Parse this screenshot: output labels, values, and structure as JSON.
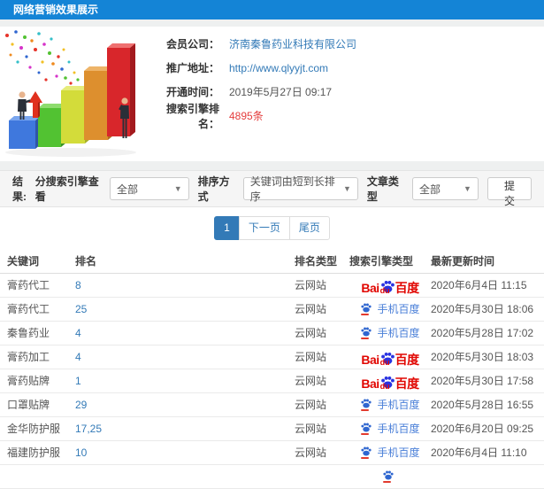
{
  "window": {
    "title": "网络营销效果展示"
  },
  "info_panel": {
    "fields": [
      {
        "label": "会员公司：",
        "value": "济南秦鲁药业科技有限公司"
      },
      {
        "label": "推广地址：",
        "value": "http://www.qlyyjt.com"
      },
      {
        "label": "开通时间：",
        "value": "2019年5月27日 09:17"
      },
      {
        "label": "搜索引擎排名：",
        "value": "4895条"
      }
    ]
  },
  "filter_bar": {
    "results_label": "结果:",
    "engine_view_label": "分搜索引擎查看",
    "engine_view_value": "全部",
    "sort_label": "排序方式",
    "sort_value": "关键词由短到长排序",
    "article_type_label": "文章类型",
    "article_type_value": "全部",
    "submit_label": "提交"
  },
  "pagination": {
    "current_page": "1",
    "next_label": "下一页",
    "last_label": "尾页"
  },
  "table": {
    "columns": [
      "关键词",
      "排名",
      "排名类型",
      "搜索引擎类型",
      "最新更新时间"
    ],
    "rows": [
      {
        "keyword": "膏药代工",
        "rank": "8",
        "rank_type": "云网站",
        "engine": "baidu",
        "updated": "2020年6月4日 11:15"
      },
      {
        "keyword": "膏药代工",
        "rank": "25",
        "rank_type": "云网站",
        "engine": "mobile",
        "updated": "2020年5月30日 18:06"
      },
      {
        "keyword": "秦鲁药业",
        "rank": "4",
        "rank_type": "云网站",
        "engine": "mobile",
        "updated": "2020年5月28日 17:02"
      },
      {
        "keyword": "膏药加工",
        "rank": "4",
        "rank_type": "云网站",
        "engine": "baidu",
        "updated": "2020年5月30日 18:03"
      },
      {
        "keyword": "膏药贴牌",
        "rank": "1",
        "rank_type": "云网站",
        "engine": "baidu",
        "updated": "2020年5月30日 17:58"
      },
      {
        "keyword": "口罩贴牌",
        "rank": "29",
        "rank_type": "云网站",
        "engine": "mobile",
        "updated": "2020年5月28日 16:55"
      },
      {
        "keyword": "金华防护服",
        "rank": "17,25",
        "rank_type": "云网站",
        "engine": "mobile",
        "updated": "2020年6月20日 09:25"
      },
      {
        "keyword": "福建防护服",
        "rank": "10",
        "rank_type": "云网站",
        "engine": "mobile",
        "updated": "2020年6月4日 11:10"
      }
    ],
    "partial_row": {
      "keyword": "",
      "rank": "",
      "rank_type": "",
      "engine": "mobile",
      "updated": ""
    }
  },
  "engine_labels": {
    "baidu": {
      "bai": "Bai",
      "du": "du",
      "cn": "百度"
    },
    "mobile": {
      "cn": "手机百度"
    }
  },
  "colors": {
    "header_bg": "#1484d6",
    "link_blue": "#337ab7",
    "highlight_red": "#e43d3d",
    "baidu_red": "#e10601",
    "baidu_blue": "#2932e1"
  }
}
